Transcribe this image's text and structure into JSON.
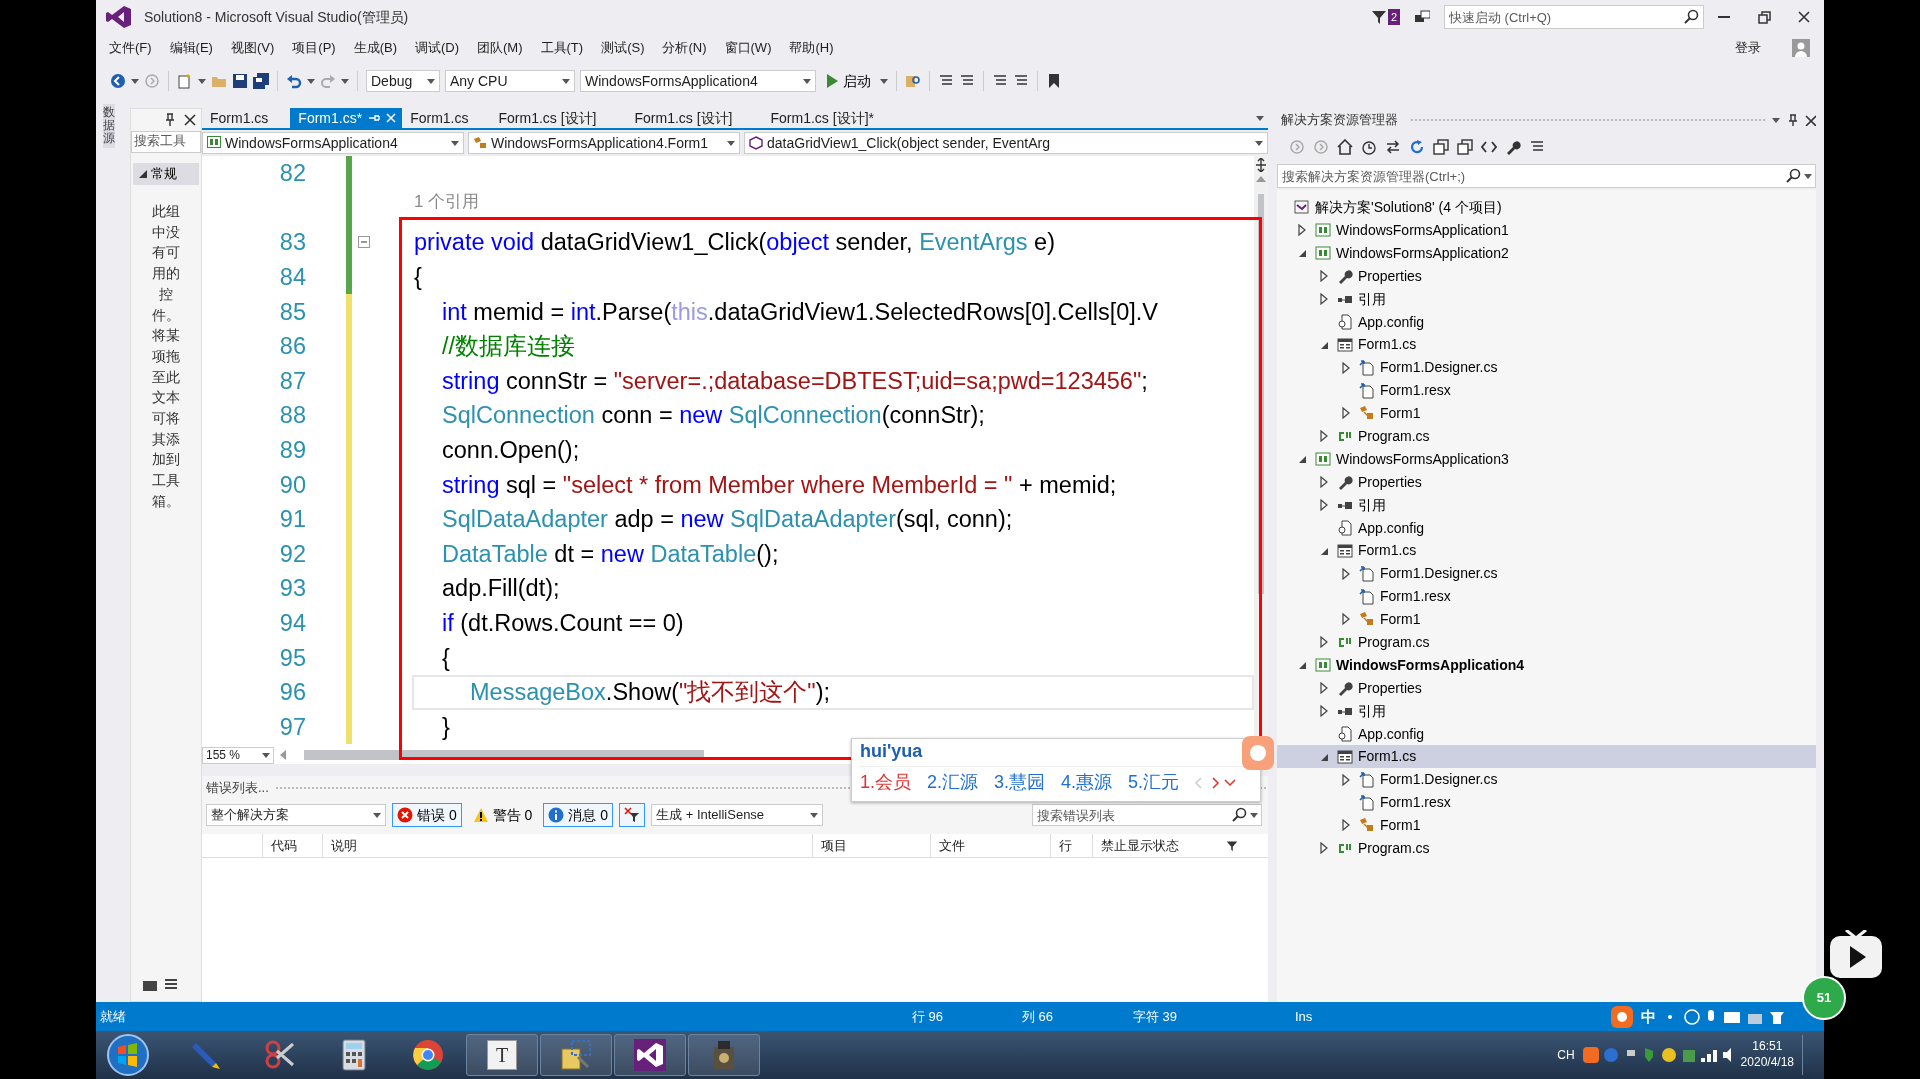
{
  "window": {
    "title": "Solution8 - Microsoft Visual Studio(管理员)",
    "notification_count": "2",
    "quick_launch": {
      "placeholder": "快速启动 (Ctrl+Q)"
    },
    "sign_in": "登录"
  },
  "menu": [
    "文件(F)",
    "编辑(E)",
    "视图(V)",
    "项目(P)",
    "生成(B)",
    "调试(D)",
    "团队(M)",
    "工具(T)",
    "测试(S)",
    "分析(N)",
    "窗口(W)",
    "帮助(H)"
  ],
  "toolbar": {
    "configuration": "Debug",
    "platform": "Any CPU",
    "startup_project": "WindowsFormsApplication4",
    "start": "启动"
  },
  "side_tabs": [
    "数据源"
  ],
  "toolbox": {
    "search": {
      "placeholder": "搜索工具"
    },
    "group": "常规",
    "expanded": true,
    "empty_text": "此组中没有可用的控件。将某项拖至此文本可将其添加到工具箱。"
  },
  "editor": {
    "tabs": [
      {
        "label": "Form1.cs",
        "selected": false,
        "pinned": false
      },
      {
        "label": "Form1.cs*",
        "selected": true,
        "pinned": true
      },
      {
        "label": "Form1.cs",
        "selected": false,
        "pinned": false
      },
      {
        "label": "Form1.cs [设计]",
        "selected": false,
        "pinned": false
      },
      {
        "label": "Form1.cs [设计]",
        "selected": false,
        "pinned": false
      },
      {
        "label": "Form1.cs [设计]*",
        "selected": false,
        "pinned": false
      }
    ],
    "navigation": [
      "WindowsFormsApplication4",
      "WindowsFormsApplication4.Form1",
      "dataGridView1_Click(object sender, EventArg"
    ],
    "lines": [
      {
        "number": "82",
        "modified": false,
        "current": false
      },
      {
        "number": "83",
        "modified": false,
        "current": false,
        "codelens": "1 个引用",
        "collapsed": false,
        "tokens": [
          {
            "kind": "keyword",
            "text": "private"
          },
          {
            "kind": "keyword",
            "text": " void"
          },
          {
            "kind": "plain",
            "text": " dataGridView1_Click("
          },
          {
            "kind": "keyword",
            "text": "object"
          },
          {
            "kind": "plain",
            "text": " sender, "
          },
          {
            "kind": "type",
            "text": "EventArgs"
          },
          {
            "kind": "plain",
            "text": " e)"
          }
        ]
      },
      {
        "number": "84",
        "modified": false,
        "current": false,
        "tokens": [
          {
            "kind": "plain",
            "text": "{"
          }
        ],
        "children": [
          {
            "number": "85",
            "modified": true,
            "current": false,
            "tokens": [
              {
                "kind": "keyword",
                "text": "int"
              },
              {
                "kind": "plain",
                "text": " memid = "
              },
              {
                "kind": "keyword",
                "text": "int"
              },
              {
                "kind": "plain",
                "text": ".Parse("
              },
              {
                "kind": "this",
                "text": "this"
              },
              {
                "kind": "plain",
                "text": ".dataGridView1.SelectedRows[0].Cells[0].V"
              }
            ]
          },
          {
            "number": "86",
            "modified": true,
            "current": false,
            "tokens": [
              {
                "kind": "comment",
                "text": "//数据库连接"
              }
            ]
          },
          {
            "number": "87",
            "modified": true,
            "current": false,
            "tokens": [
              {
                "kind": "keyword",
                "text": "string"
              },
              {
                "kind": "plain",
                "text": " connStr = "
              },
              {
                "kind": "string",
                "text": "\"server=.;database=DBTEST;uid=sa;pwd=123456\""
              },
              {
                "kind": "plain",
                "text": ";"
              }
            ]
          },
          {
            "number": "88",
            "modified": true,
            "current": false,
            "tokens": [
              {
                "kind": "type",
                "text": "SqlConnection"
              },
              {
                "kind": "plain",
                "text": " conn = "
              },
              {
                "kind": "keyword",
                "text": "new"
              },
              {
                "kind": "type",
                "text": " SqlConnection"
              },
              {
                "kind": "plain",
                "text": "(connStr);"
              }
            ]
          },
          {
            "number": "89",
            "modified": true,
            "current": false,
            "tokens": [
              {
                "kind": "plain",
                "text": "conn.Open();"
              }
            ]
          },
          {
            "number": "90",
            "modified": true,
            "current": false,
            "tokens": [
              {
                "kind": "keyword",
                "text": "string"
              },
              {
                "kind": "plain",
                "text": " sql = "
              },
              {
                "kind": "string",
                "text": "\"select * from Member where MemberId = \""
              },
              {
                "kind": "plain",
                "text": " + memid;"
              }
            ]
          },
          {
            "number": "91",
            "modified": true,
            "current": false,
            "tokens": [
              {
                "kind": "type",
                "text": "SqlDataAdapter"
              },
              {
                "kind": "plain",
                "text": " adp = "
              },
              {
                "kind": "keyword",
                "text": "new"
              },
              {
                "kind": "type",
                "text": " SqlDataAdapter"
              },
              {
                "kind": "plain",
                "text": "(sql, conn);"
              }
            ]
          },
          {
            "number": "92",
            "modified": true,
            "current": false,
            "tokens": [
              {
                "kind": "type",
                "text": "DataTable"
              },
              {
                "kind": "plain",
                "text": " dt = "
              },
              {
                "kind": "keyword",
                "text": "new"
              },
              {
                "kind": "type",
                "text": " DataTable"
              },
              {
                "kind": "plain",
                "text": "();"
              }
            ]
          },
          {
            "number": "93",
            "modified": true,
            "current": false,
            "tokens": [
              {
                "kind": "plain",
                "text": "adp.Fill(dt);"
              }
            ]
          },
          {
            "number": "94",
            "modified": true,
            "current": false,
            "tokens": [
              {
                "kind": "keyword",
                "text": "if"
              },
              {
                "kind": "plain",
                "text": " (dt.Rows.Count == 0)"
              }
            ]
          },
          {
            "number": "95",
            "modified": true,
            "current": false,
            "tokens": [
              {
                "kind": "plain",
                "text": "{"
              }
            ],
            "children": [
              {
                "number": "96",
                "modified": true,
                "current": true,
                "tokens": [
                  {
                    "kind": "type",
                    "text": "MessageBox"
                  },
                  {
                    "kind": "plain",
                    "text": ".Show("
                  },
                  {
                    "kind": "string",
                    "text": "\"找不到这个\""
                  },
                  {
                    "kind": "plain",
                    "text": ");"
                  }
                ]
              }
            ]
          },
          {
            "number": "97",
            "modified": true,
            "current": false,
            "tokens": [
              {
                "kind": "plain",
                "text": "}"
              }
            ]
          }
        ]
      }
    ],
    "zoom": "155 %"
  },
  "ime": {
    "composition": "hui'yua",
    "candidates": [
      {
        "label": "1.会员",
        "selected": true
      },
      {
        "label": "2.汇源",
        "selected": false
      },
      {
        "label": "3.慧园",
        "selected": false
      },
      {
        "label": "4.惠源",
        "selected": false
      },
      {
        "label": "5.汇元",
        "selected": false
      }
    ]
  },
  "error_list": {
    "title": "错误列表...",
    "scope": "整个解决方案",
    "filters": [
      {
        "kind": "error",
        "label": "错误 0",
        "selected": true
      },
      {
        "kind": "warning",
        "label": "警告 0",
        "selected": false
      },
      {
        "kind": "message",
        "label": "消息 0",
        "selected": true
      }
    ],
    "source": "生成 + IntelliSense",
    "search": {
      "placeholder": "搜索错误列表"
    },
    "columns": [
      "代码",
      "说明",
      "项目",
      "文件",
      "行",
      "禁止显示状态"
    ]
  },
  "solution_explorer": {
    "title": "解决方案资源管理器",
    "search": {
      "placeholder": "搜索解决方案资源管理器(Ctrl+;)"
    },
    "tree": [
      {
        "kind": "solution",
        "label": "解决方案'Solution8' (4 个项目)",
        "selected": false,
        "children": [
          {
            "kind": "project",
            "label": "WindowsFormsApplication1",
            "expanded": false,
            "startup": false,
            "selected": false
          },
          {
            "kind": "project",
            "label": "WindowsFormsApplication2",
            "expanded": true,
            "startup": false,
            "selected": false,
            "children": [
              {
                "kind": "properties",
                "label": "Properties",
                "expanded": false,
                "selected": false
              },
              {
                "kind": "references",
                "label": "引用",
                "expanded": false,
                "selected": false
              },
              {
                "kind": "config",
                "label": "App.config",
                "selected": false
              },
              {
                "kind": "form",
                "label": "Form1.cs",
                "expanded": true,
                "selected": false,
                "children": [
                  {
                    "kind": "designer",
                    "label": "Form1.Designer.cs",
                    "expanded": false,
                    "selected": false
                  },
                  {
                    "kind": "resx",
                    "label": "Form1.resx",
                    "selected": false
                  },
                  {
                    "kind": "class",
                    "label": "Form1",
                    "expanded": false,
                    "selected": false
                  }
                ]
              },
              {
                "kind": "csfile",
                "label": "Program.cs",
                "expanded": false,
                "selected": false
              }
            ]
          },
          {
            "kind": "project",
            "label": "WindowsFormsApplication3",
            "expanded": true,
            "startup": false,
            "selected": false,
            "children": [
              {
                "kind": "properties",
                "label": "Properties",
                "expanded": false,
                "selected": false
              },
              {
                "kind": "references",
                "label": "引用",
                "expanded": false,
                "selected": false
              },
              {
                "kind": "config",
                "label": "App.config",
                "selected": false
              },
              {
                "kind": "form",
                "label": "Form1.cs",
                "expanded": true,
                "selected": false,
                "children": [
                  {
                    "kind": "designer",
                    "label": "Form1.Designer.cs",
                    "expanded": false,
                    "selected": false
                  },
                  {
                    "kind": "resx",
                    "label": "Form1.resx",
                    "selected": false
                  },
                  {
                    "kind": "class",
                    "label": "Form1",
                    "expanded": false,
                    "selected": false
                  }
                ]
              },
              {
                "kind": "csfile",
                "label": "Program.cs",
                "expanded": false,
                "selected": false
              }
            ]
          },
          {
            "kind": "project",
            "label": "WindowsFormsApplication4",
            "expanded": true,
            "startup": true,
            "selected": false,
            "children": [
              {
                "kind": "properties",
                "label": "Properties",
                "expanded": false,
                "selected": false
              },
              {
                "kind": "references",
                "label": "引用",
                "expanded": false,
                "selected": false
              },
              {
                "kind": "config",
                "label": "App.config",
                "selected": false
              },
              {
                "kind": "form",
                "label": "Form1.cs",
                "expanded": true,
                "selected": true,
                "children": [
                  {
                    "kind": "designer",
                    "label": "Form1.Designer.cs",
                    "expanded": false,
                    "selected": false
                  },
                  {
                    "kind": "resx",
                    "label": "Form1.resx",
                    "selected": false
                  },
                  {
                    "kind": "class",
                    "label": "Form1",
                    "expanded": false,
                    "selected": false
                  }
                ]
              },
              {
                "kind": "csfile",
                "label": "Program.cs",
                "expanded": false,
                "selected": false
              }
            ]
          }
        ]
      }
    ]
  },
  "status_bar": {
    "text": "就绪",
    "line": "行 96",
    "column": "列 66",
    "character": "字符 39",
    "mode": "Ins",
    "ime_mode": "中"
  },
  "taskbar": {
    "apps": [
      {
        "kind": "pen",
        "running": false
      },
      {
        "kind": "scissors",
        "running": false
      },
      {
        "kind": "calculator",
        "running": false
      },
      {
        "kind": "browser",
        "running": false
      },
      {
        "kind": "text",
        "glyph": "T",
        "running": true
      },
      {
        "kind": "tools",
        "running": true
      },
      {
        "kind": "studio",
        "running": true
      },
      {
        "kind": "camera",
        "running": true
      }
    ],
    "language": "CH",
    "time": "16:51",
    "date": "2020/4/18"
  },
  "overlay_badge": "51"
}
